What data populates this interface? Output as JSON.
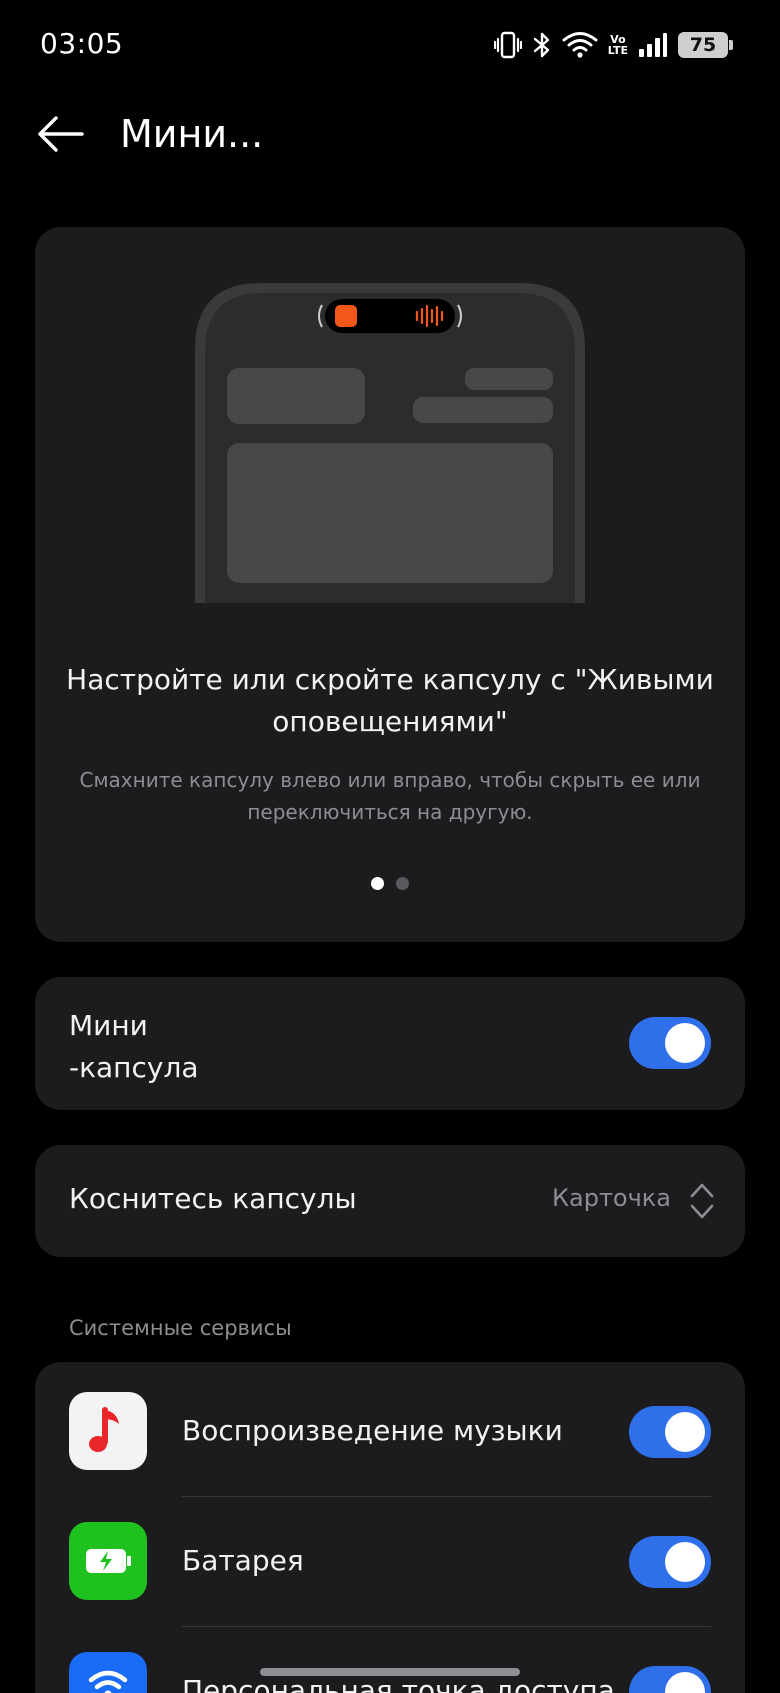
{
  "status_bar": {
    "time": "03:05",
    "icons": [
      "vibrate-icon",
      "bluetooth-icon",
      "wifi-icon",
      "volte-icon",
      "signal-icon",
      "battery-icon"
    ],
    "volte_top": "Vo",
    "volte_bottom": "LTE",
    "battery_level": "75"
  },
  "header": {
    "back_icon": "back-arrow-icon",
    "title": "Мини..."
  },
  "hero": {
    "title": "Настройте или скройте капсулу с \"Живыми оповещениями\"",
    "description": "Смахните капсулу влево или вправо, чтобы скрыть ее или переключиться на другую.",
    "page_count": 2,
    "active_page": 1,
    "capsule_accent": "#f2581c"
  },
  "mini_capsule": {
    "label": "Мини\n-капсула",
    "enabled": true
  },
  "tap_capsule": {
    "label": "Коснитесь капсулы",
    "value": "Карточка",
    "chevron_icon": "up-down-chevron-icon"
  },
  "system_services": {
    "header": "Системные сервисы",
    "items": [
      {
        "label": "Воспроизведение музыки",
        "icon": "music-note-icon",
        "icon_bg": "#f3f3f5",
        "enabled": true
      },
      {
        "label": "Батарея",
        "icon": "battery-charging-icon",
        "icon_bg": "#1fc11f",
        "enabled": true
      },
      {
        "label": "Персональная точка доступа",
        "icon": "hotspot-icon",
        "icon_bg": "#1a6cf5",
        "enabled": true
      }
    ]
  },
  "colors": {
    "background": "#000000",
    "card": "#1c1c1e",
    "toggle_on": "#2f6fea",
    "secondary_text": "#8d8d92"
  }
}
